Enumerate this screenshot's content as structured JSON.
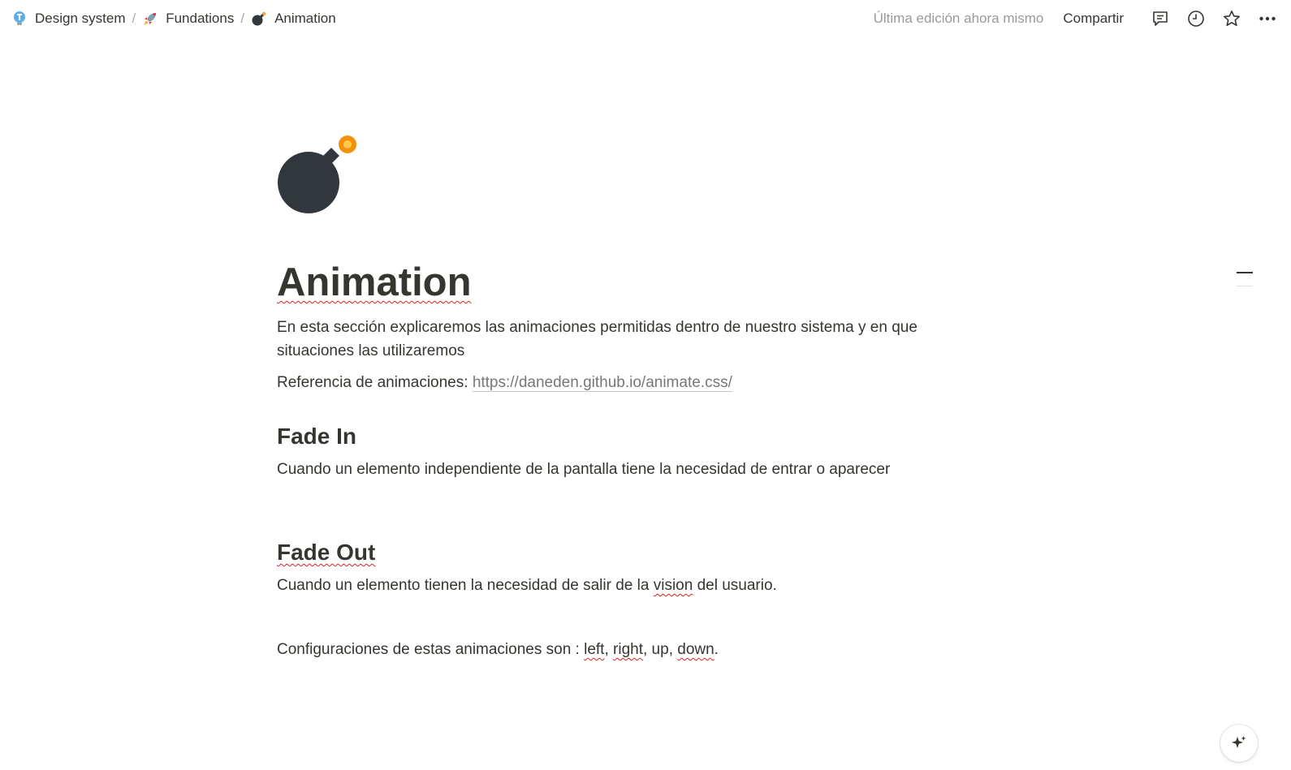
{
  "breadcrumb": {
    "items": [
      {
        "label": "Design system",
        "icon": "lightbulb-icon"
      },
      {
        "label": "Fundations",
        "icon": "rocket-icon"
      },
      {
        "label": "Animation",
        "icon": "bomb-icon"
      }
    ],
    "separator": "/"
  },
  "toolbar": {
    "last_edit": "Última edición ahora mismo",
    "share_label": "Compartir",
    "icons": [
      "comment-icon",
      "clock-icon",
      "star-icon",
      "more-icon"
    ]
  },
  "page": {
    "icon": "bomb-icon",
    "title": "Animation",
    "intro": "En esta sección explicaremos las animaciones permitidas dentro de nuestro sistema y en que situaciones las utilizaremos",
    "reference_label": "Referencia de animaciones: ",
    "reference_url": "https://daneden.github.io/animate.css/",
    "sections": [
      {
        "heading_words": [
          "Fade",
          "Out"
        ],
        "heading": "Fade In",
        "body": "Cuando un elemento independiente de la pantalla tiene la necesidad de entrar o aparecer"
      },
      {
        "heading": "Fade Out",
        "body_before": "Cuando un elemento tienen la necesidad de salir de la ",
        "body_flag": "vision",
        "body_after": " del usuario."
      }
    ],
    "config": {
      "prefix": "Configuraciones de estas animaciones son : ",
      "opt_left": "left",
      "sep1": ", ",
      "opt_right": "right",
      "sep2": ", up, ",
      "opt_down": "down",
      "suffix": "."
    }
  },
  "colors": {
    "text": "#37352f",
    "muted": "#9b9a97",
    "spellcheck": "#e02020",
    "bomb_body": "#31373d",
    "fuse_spark": "#f4900c"
  }
}
